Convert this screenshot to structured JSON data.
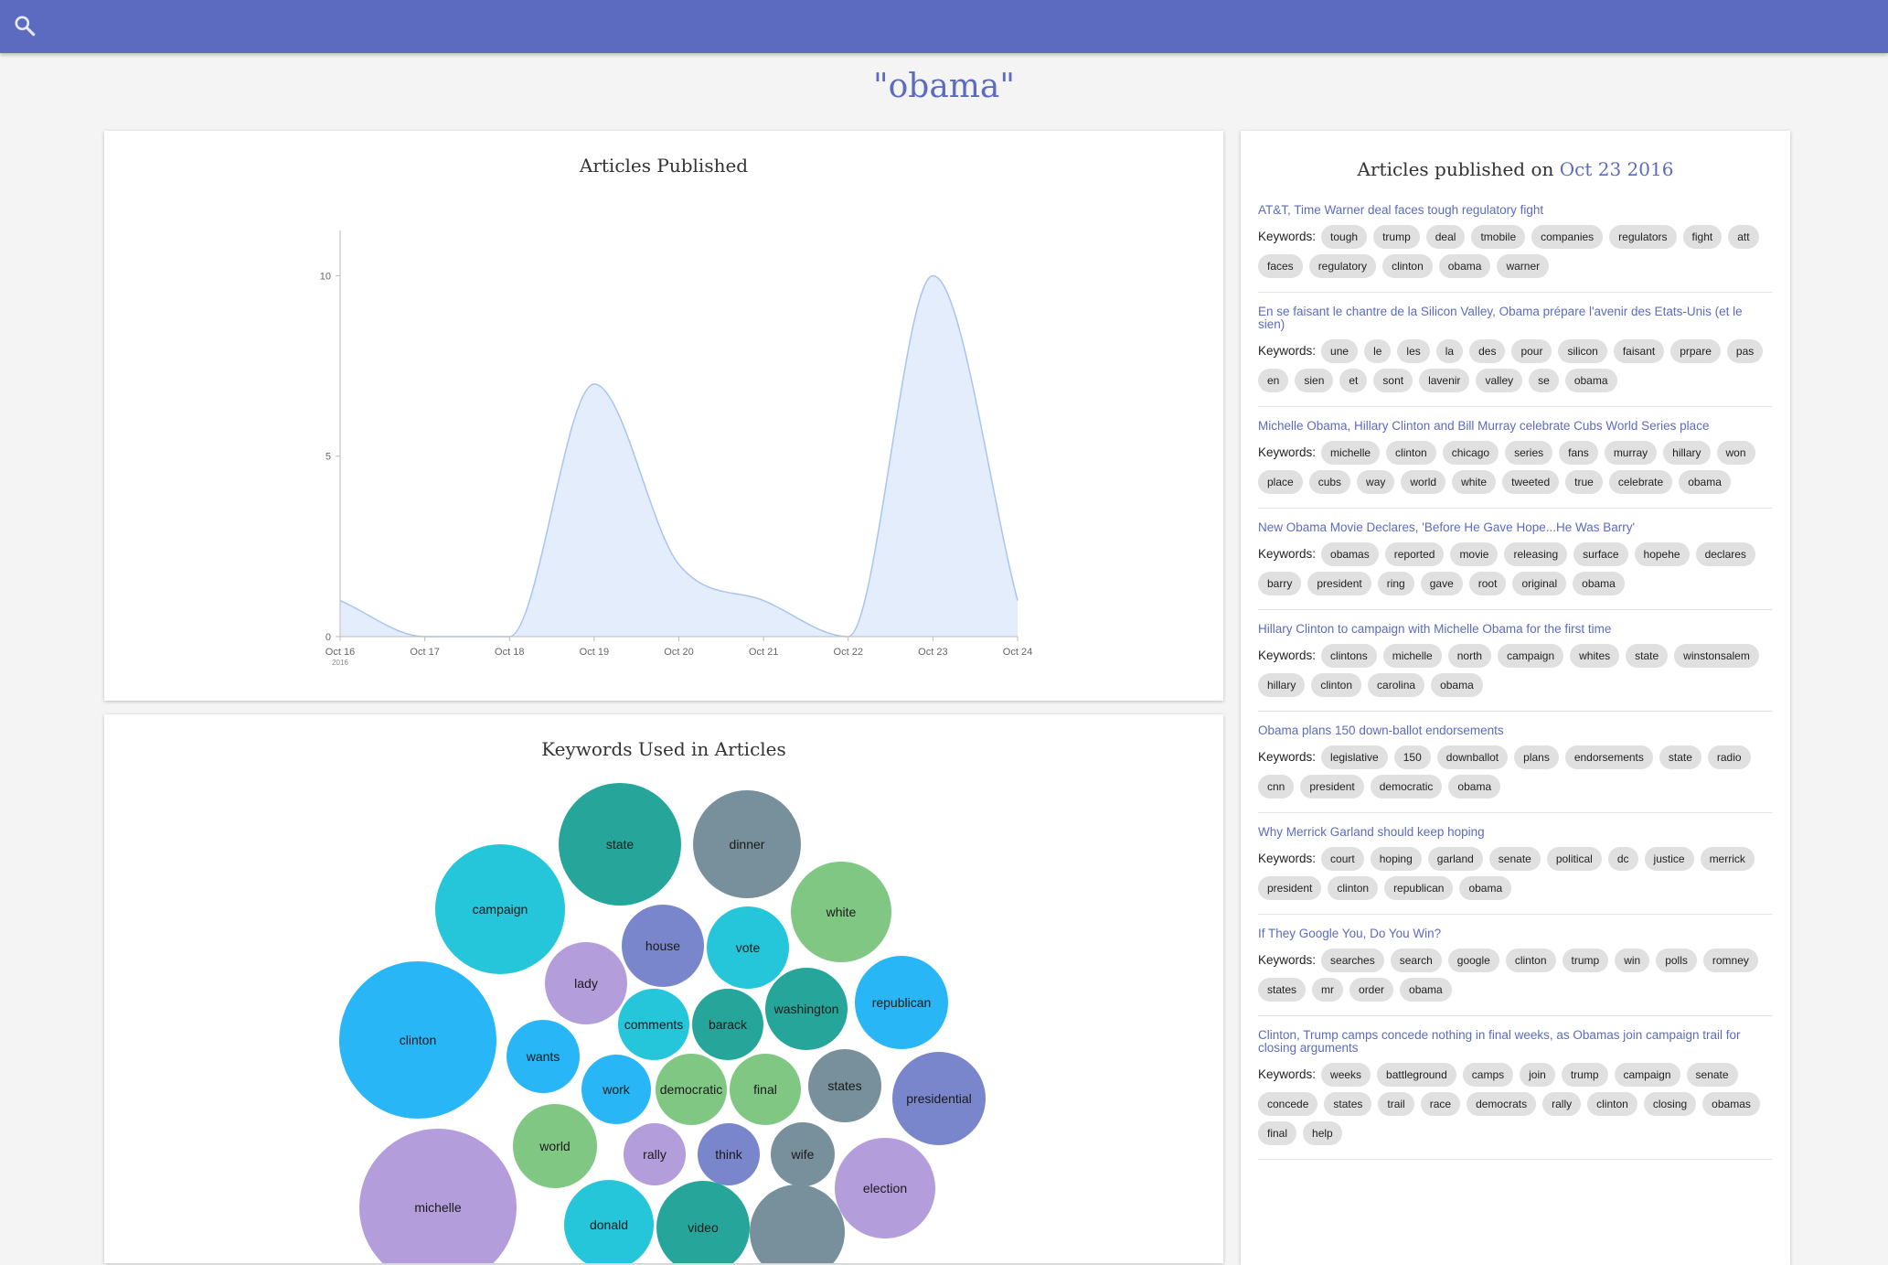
{
  "header": {
    "search_icon": "search-icon"
  },
  "query": "\"obama\"",
  "colors": {
    "accent": "#5c6bc0",
    "area_fill": "#e3edfc",
    "area_stroke": "#a9c4ee"
  },
  "chart_title": "Articles Published",
  "chart_data": {
    "type": "area",
    "x": [
      "Oct 16",
      "Oct 17",
      "Oct 18",
      "Oct 19",
      "Oct 20",
      "Oct 21",
      "Oct 22",
      "Oct 23",
      "Oct 24"
    ],
    "x_sublabel": "2016",
    "values": [
      1,
      0,
      0,
      7,
      2,
      1,
      0,
      10,
      1
    ],
    "ylim": [
      0,
      11
    ],
    "yticks": [
      0,
      5,
      10
    ],
    "title": "Articles Published"
  },
  "bubble_title": "Keywords Used in Articles",
  "bubbles": [
    {
      "label": "state",
      "color": "#26a69a"
    },
    {
      "label": "dinner",
      "color": "#78909c"
    },
    {
      "label": "campaign",
      "color": "#26c6da"
    },
    {
      "label": "white",
      "color": "#81c784"
    },
    {
      "label": "house",
      "color": "#7986cb"
    },
    {
      "label": "vote",
      "color": "#26c6da"
    },
    {
      "label": "lady",
      "color": "#b39ddb"
    },
    {
      "label": "republican",
      "color": "#29b6f6"
    },
    {
      "label": "washington",
      "color": "#26a69a"
    },
    {
      "label": "comments",
      "color": "#26c6da"
    },
    {
      "label": "barack",
      "color": "#26a69a"
    },
    {
      "label": "clinton",
      "color": "#29b6f6"
    },
    {
      "label": "wants",
      "color": "#29b6f6"
    },
    {
      "label": "states",
      "color": "#78909c"
    },
    {
      "label": "presidential",
      "color": "#7986cb"
    },
    {
      "label": "work",
      "color": "#29b6f6"
    },
    {
      "label": "democratic",
      "color": "#81c784"
    },
    {
      "label": "final",
      "color": "#81c784"
    },
    {
      "label": "world",
      "color": "#81c784"
    },
    {
      "label": "rally",
      "color": "#b39ddb"
    },
    {
      "label": "think",
      "color": "#7986cb"
    },
    {
      "label": "wife",
      "color": "#78909c"
    },
    {
      "label": "election",
      "color": "#b39ddb"
    },
    {
      "label": "michelle",
      "color": "#b39ddb"
    },
    {
      "label": "donald",
      "color": "#26c6da"
    },
    {
      "label": "video",
      "color": "#26a69a"
    },
    {
      "label": "",
      "color": "#78909c"
    }
  ],
  "articles_panel": {
    "title_prefix": "Articles published on ",
    "date": "Oct 23 2016",
    "keywords_label": "Keywords:"
  },
  "articles": [
    {
      "title": "AT&T, Time Warner deal faces tough regulatory fight",
      "keywords": [
        "tough",
        "trump",
        "deal",
        "tmobile",
        "companies",
        "regulators",
        "fight",
        "att",
        "faces",
        "regulatory",
        "clinton",
        "obama",
        "warner"
      ]
    },
    {
      "title": "En se faisant le chantre de la Silicon Valley, Obama prépare l'avenir des Etats-Unis (et le sien)",
      "keywords": [
        "une",
        "le",
        "les",
        "la",
        "des",
        "pour",
        "silicon",
        "faisant",
        "prpare",
        "pas",
        "en",
        "sien",
        "et",
        "sont",
        "lavenir",
        "valley",
        "se",
        "obama"
      ]
    },
    {
      "title": "Michelle Obama, Hillary Clinton and Bill Murray celebrate Cubs World Series place",
      "keywords": [
        "michelle",
        "clinton",
        "chicago",
        "series",
        "fans",
        "murray",
        "hillary",
        "won",
        "place",
        "cubs",
        "way",
        "world",
        "white",
        "tweeted",
        "true",
        "celebrate",
        "obama"
      ]
    },
    {
      "title": "New Obama Movie Declares, 'Before He Gave Hope...He Was Barry'",
      "keywords": [
        "obamas",
        "reported",
        "movie",
        "releasing",
        "surface",
        "hopehe",
        "declares",
        "barry",
        "president",
        "ring",
        "gave",
        "root",
        "original",
        "obama"
      ]
    },
    {
      "title": "Hillary Clinton to campaign with Michelle Obama for the first time",
      "keywords": [
        "clintons",
        "michelle",
        "north",
        "campaign",
        "whites",
        "state",
        "winstonsalem",
        "hillary",
        "clinton",
        "carolina",
        "obama"
      ]
    },
    {
      "title": "Obama plans 150 down-ballot endorsements",
      "keywords": [
        "legislative",
        "150",
        "downballot",
        "plans",
        "endorsements",
        "state",
        "radio",
        "cnn",
        "president",
        "democratic",
        "obama"
      ]
    },
    {
      "title": "Why Merrick Garland should keep hoping",
      "keywords": [
        "court",
        "hoping",
        "garland",
        "senate",
        "political",
        "dc",
        "justice",
        "merrick",
        "president",
        "clinton",
        "republican",
        "obama"
      ]
    },
    {
      "title": "If They Google You, Do You Win?",
      "keywords": [
        "searches",
        "search",
        "google",
        "clinton",
        "trump",
        "win",
        "polls",
        "romney",
        "states",
        "mr",
        "order",
        "obama"
      ]
    },
    {
      "title": "Clinton, Trump camps concede nothing in final weeks, as Obamas join campaign trail for closing arguments",
      "keywords": [
        "weeks",
        "battleground",
        "camps",
        "join",
        "trump",
        "campaign",
        "senate",
        "concede",
        "states",
        "trail",
        "race",
        "democrats",
        "rally",
        "clinton",
        "closing",
        "obamas",
        "final",
        "help"
      ]
    }
  ]
}
